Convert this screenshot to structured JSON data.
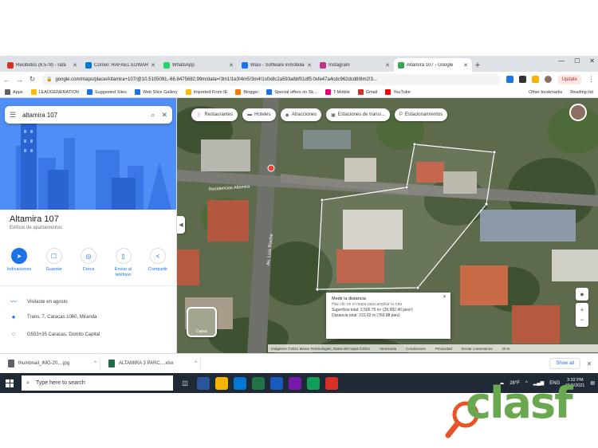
{
  "browser": {
    "tabs": [
      {
        "label": "Recibidos (6.578) - rafa",
        "color": "#d93025"
      },
      {
        "label": "Correo: RAFAEL EDWARD",
        "color": "#0078d4"
      },
      {
        "label": "WhatsApp",
        "color": "#25d366"
      },
      {
        "label": "Wasi - Software inmobiliario",
        "color": "#1a73e8"
      },
      {
        "label": "Instagram",
        "color": "#c13584"
      },
      {
        "label": "Altamira 107 - Google",
        "color": "#34a853",
        "active": true
      }
    ],
    "new_tab": "+",
    "url": "google.com/maps/place/Altamira+107/@10.5105091,-66.8475692,99m/data=!3m1!1e3!4m5!3m4!1s0x8c2a593a6bf01df5:0xfe47a4cdc962dcd8!8m2!3...",
    "update_label": "Update",
    "bookmarks": [
      {
        "label": "Apps",
        "color": "#5f6368"
      },
      {
        "label": "LEADGENERATION",
        "color": "#fbbc04"
      },
      {
        "label": "Suggested Sites",
        "color": "#1a73e8"
      },
      {
        "label": "Web Slice Gallery",
        "color": "#1a73e8"
      },
      {
        "label": "Imported From IE",
        "color": "#fbbc04"
      },
      {
        "label": "Blogger",
        "color": "#f57c00"
      },
      {
        "label": "Special offers on Sk...",
        "color": "#1a73e8"
      },
      {
        "label": "T-Mobile",
        "color": "#e20074"
      },
      {
        "label": "Gmail",
        "color": "#d93025"
      },
      {
        "label": "YouTube",
        "color": "#ff0000"
      }
    ],
    "bookmarks_right": [
      "Other bookmarks",
      "Reading list"
    ]
  },
  "maps": {
    "search_query": "altamira 107",
    "place_title": "Altamira 107",
    "place_subtitle": "Edificio de apartamentos",
    "actions": [
      {
        "label": "Indicaciones",
        "icon": "directions-icon",
        "glyph": "➤",
        "primary": true
      },
      {
        "label": "Guardar",
        "icon": "bookmark-icon",
        "glyph": "☐"
      },
      {
        "label": "Cerca",
        "icon": "nearby-icon",
        "glyph": "◎"
      },
      {
        "label": "Enviar al teléfono",
        "icon": "phone-icon",
        "glyph": "▯"
      },
      {
        "label": "Compartir",
        "icon": "share-icon",
        "glyph": "<"
      }
    ],
    "info": [
      {
        "icon": "timeline-icon",
        "glyph": "〰",
        "text": "Visitaste en agosto"
      },
      {
        "icon": "location-pin-icon",
        "glyph": "●",
        "text": "Trans. 7, Caracas 1060, Miranda"
      },
      {
        "icon": "plus-code-icon",
        "glyph": "⁘",
        "text": "G553+35 Caracas, Distrito Capital"
      }
    ],
    "chips": [
      {
        "label": "Restaurantes",
        "icon": "restaurant-icon",
        "glyph": "🍴"
      },
      {
        "label": "Hoteles",
        "icon": "hotel-icon",
        "glyph": "▬"
      },
      {
        "label": "Atracciones",
        "icon": "attractions-icon",
        "glyph": "◉"
      },
      {
        "label": "Estaciones de transi...",
        "icon": "transit-icon",
        "glyph": "▣"
      },
      {
        "label": "Estacionamientos",
        "icon": "parking-icon",
        "glyph": "P"
      }
    ],
    "street_labels": [
      "Av. Luis Roche",
      "Residencias Altamira"
    ],
    "measure": {
      "title": "Medir la distancia",
      "hint": "Haz clic en el mapa para ampliar la ruta",
      "area": "Superficie total: 2,506.75 m² (26,982.40 pies²)",
      "distance": "Distancia total: 231.92 m (760.88 pies)"
    },
    "layers_label": "Capas",
    "attribution": [
      "Imágenes ©2021 Maxar Technologies, Datos del mapa ©2021",
      "Venezuela",
      "Condiciones",
      "Privacidad",
      "Enviar comentarios",
      "20 m"
    ]
  },
  "downloads": {
    "items": [
      {
        "label": "thumbnail_IMG-20....jpg",
        "color": "#5f6368"
      },
      {
        "label": "ALTAMIRA 3 PARC....xlsx",
        "color": "#1e7145"
      }
    ],
    "show_all": "Show all"
  },
  "taskbar": {
    "search_placeholder": "Type here to search",
    "weather": "28°F",
    "lang": "ENG",
    "time": "3:32 PM",
    "date": "11/3/2021"
  },
  "watermark": {
    "text": "clasf"
  }
}
